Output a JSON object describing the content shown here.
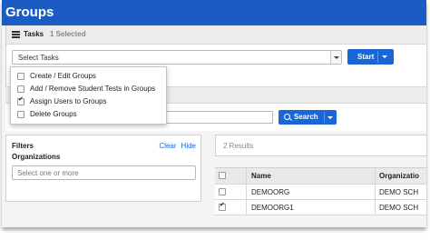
{
  "header": {
    "title": "Groups"
  },
  "tasks": {
    "label": "Tasks",
    "selected_count": "1 Selected",
    "select_value": "Select Tasks",
    "start_label": "Start",
    "menu": [
      {
        "label": "Create / Edit Groups",
        "checked": false
      },
      {
        "label": "Add / Remove Student Tests in Groups",
        "checked": false
      },
      {
        "label": "Assign Users to Groups",
        "checked": true
      },
      {
        "label": "Delete Groups",
        "checked": false
      }
    ]
  },
  "search": {
    "button_label": "Search"
  },
  "filters": {
    "title": "Filters",
    "clear_label": "Clear",
    "hide_label": "Hide",
    "organizations_label": "Organizations",
    "organizations_placeholder": "Select one or more"
  },
  "results": {
    "count_text": "2 Results",
    "columns": [
      "Name",
      "Organizatio"
    ],
    "rows": [
      {
        "name": "DEMOORG",
        "organization": "DEMO SCH",
        "checked": false
      },
      {
        "name": "DEMOORG1",
        "organization": "DEMO SCH",
        "checked": true
      }
    ]
  },
  "colors": {
    "header_blue": "#1b5cc4",
    "button_blue": "#1b66d6",
    "link_blue": "#1b66d6"
  }
}
